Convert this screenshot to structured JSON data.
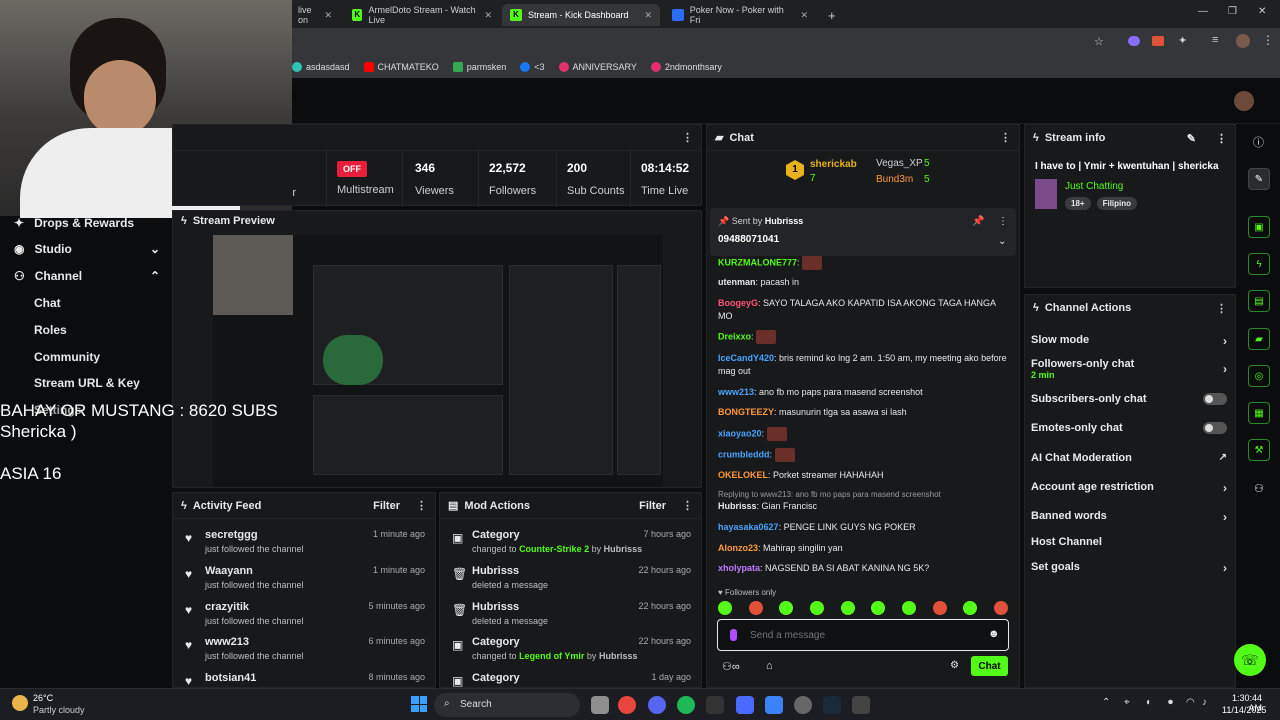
{
  "browser": {
    "tabs": [
      {
        "label": "live on",
        "partial": true
      },
      {
        "label": "ArmelDoto Stream - Watch Live"
      },
      {
        "label": "Stream - Kick Dashboard",
        "active": true
      },
      {
        "label": "Poker Now - Poker with Fri"
      }
    ],
    "new_tab": "+",
    "bookmarks": [
      "asdasdasd",
      "CHATMATEKO",
      "parmsken",
      "<3",
      "ANNIVERSARY",
      "2ndmonthsary"
    ]
  },
  "sidebar": {
    "items": [
      {
        "label": "Drops & Rewards"
      },
      {
        "label": "Studio",
        "chevron": "down"
      },
      {
        "label": "Channel",
        "chevron": "up"
      }
    ],
    "channel_sub": [
      "Chat",
      "Roles",
      "Community",
      "Stream URL & Key"
    ],
    "settings_partial": "Settings"
  },
  "overlay": {
    "line1": "BAHAY OR MUSTANG : 8620 SUBS",
    "line2": "Shericka )",
    "line3": "ASIA 16"
  },
  "stats": {
    "partial_label": "r",
    "multistream_badge": "OFF",
    "multistream_label": "Multistream",
    "viewers": "346",
    "viewers_label": "Viewers",
    "followers": "22,572",
    "followers_label": "Followers",
    "subs": "200",
    "subs_label": "Sub Counts",
    "time": "08:14:52",
    "time_label": "Time Live"
  },
  "preview": {
    "title": "Stream Preview"
  },
  "activity": {
    "title": "Activity Feed",
    "filter": "Filter",
    "rows": [
      {
        "name": "secretggg",
        "action": "just followed the channel",
        "time": "1 minute ago"
      },
      {
        "name": "Waayann",
        "action": "just followed the channel",
        "time": "1 minute ago"
      },
      {
        "name": "crazyitik",
        "action": "just followed the channel",
        "time": "5 minutes ago"
      },
      {
        "name": "www213",
        "action": "just followed the channel",
        "time": "6 minutes ago"
      },
      {
        "name": "botsian41",
        "action": "",
        "time": "8 minutes ago"
      }
    ]
  },
  "mod": {
    "title": "Mod Actions",
    "filter": "Filter",
    "rows": [
      {
        "name": "Category",
        "pre": "changed to",
        "target": "Counter-Strike 2",
        "by": "by",
        "who": "Hubrisss",
        "time": "7 hours ago"
      },
      {
        "name": "Hubrisss",
        "pre": "deleted a message",
        "target": "",
        "by": "",
        "who": "",
        "time": "22 hours ago"
      },
      {
        "name": "Hubrisss",
        "pre": "deleted a message",
        "target": "",
        "by": "",
        "who": "",
        "time": "22 hours ago"
      },
      {
        "name": "Category",
        "pre": "changed to",
        "target": "Legend of Ymir",
        "by": "by",
        "who": "Hubrisss",
        "time": "22 hours ago"
      },
      {
        "name": "Category",
        "pre": "",
        "target": "",
        "by": "",
        "who": "",
        "time": "1 day ago"
      }
    ]
  },
  "chat": {
    "title": "Chat",
    "leader1": {
      "rank": "1",
      "name": "sherickab",
      "count": "7"
    },
    "leader2": {
      "name": "Vegas_XP",
      "count": "5"
    },
    "leader3": {
      "name": "Bund3m",
      "count": "5"
    },
    "pinned": {
      "sent_by": "Sent by",
      "user": "Hubrisss",
      "text": "09488071041"
    },
    "messages": [
      {
        "user": "KURZMALONE777",
        "text": "",
        "color": "#53fc18"
      },
      {
        "user": "utenman",
        "text": "pacash in",
        "color": "#ffffff"
      },
      {
        "user": "BoogeyG",
        "text": "SAYO TALAGA AKO KAPATID ISA AKONG TAGA HANGA MO",
        "color": "#ff5577"
      },
      {
        "user": "Dreixxo",
        "text": "",
        "color": "#53fc18"
      },
      {
        "user": "IceCandY420",
        "text": "bris remind ko lng 2 am. 1:50 am, my meeting ako before mag out",
        "color": "#4aa3ff"
      },
      {
        "user": "www213",
        "text": "ano fb mo paps para masend screenshot",
        "color": "#4aa3ff"
      },
      {
        "user": "BONGTEEZY",
        "text": "masunurin tlga sa asawa si lash",
        "color": "#ff9a3c"
      },
      {
        "user": "xiaoyao20",
        "text": "",
        "color": "#4aa3ff"
      },
      {
        "user": "crumbleddd",
        "text": "",
        "color": "#4aa3ff"
      },
      {
        "user": "OKELOKEL",
        "text": "Porket streamer HAHAHAH",
        "color": "#ff9a3c"
      },
      {
        "user": "Hubrisss",
        "text": "Gian Francisc",
        "color": "#ffffff",
        "reply": "Replying to www213: ano fb mo paps para masend screenshot"
      },
      {
        "user": "hayasaka0627",
        "text": "PENGE LINK GUYS NG POKER",
        "color": "#4aa3ff"
      },
      {
        "user": "Alonzo23",
        "text": "Mahirap singilin yan",
        "color": "#ff9a3c"
      },
      {
        "user": "xholypata",
        "text": "NAGSEND BA SI ABAT KANINA NG 5K?",
        "color": "#c07bff"
      }
    ],
    "followers_only": "Followers only",
    "input_placeholder": "Send a message",
    "send": "Chat"
  },
  "stream_info": {
    "title": "Stream info",
    "stream_title": "I have to | Ymir + kwentuhan | shericka",
    "category": "Just Chatting",
    "tags": [
      "18+",
      "Filipino"
    ]
  },
  "channel_actions": {
    "title": "Channel Actions",
    "rows": [
      {
        "label": "Slow mode",
        "control": "chevron",
        "sub": ""
      },
      {
        "label": "Followers-only chat",
        "control": "chevron",
        "sub": "2 min"
      },
      {
        "label": "Subscribers-only chat",
        "control": "toggle",
        "sub": ""
      },
      {
        "label": "Emotes-only chat",
        "control": "toggle",
        "sub": ""
      },
      {
        "label": "AI Chat Moderation",
        "control": "external",
        "sub": ""
      },
      {
        "label": "Account age restriction",
        "control": "chevron",
        "sub": ""
      },
      {
        "label": "Banned words",
        "control": "chevron",
        "sub": ""
      },
      {
        "label": "Host Channel",
        "control": "none",
        "sub": ""
      },
      {
        "label": "Set goals",
        "control": "chevron",
        "sub": ""
      }
    ]
  },
  "taskbar": {
    "weather_temp": "26°C",
    "weather_desc": "Partly cloudy",
    "search": "Search",
    "time": "1:30:44 AM",
    "date": "11/14/2025"
  },
  "colors": {
    "accent": "#53fc18",
    "panel": "#18191b",
    "live": "#e61e3c"
  }
}
